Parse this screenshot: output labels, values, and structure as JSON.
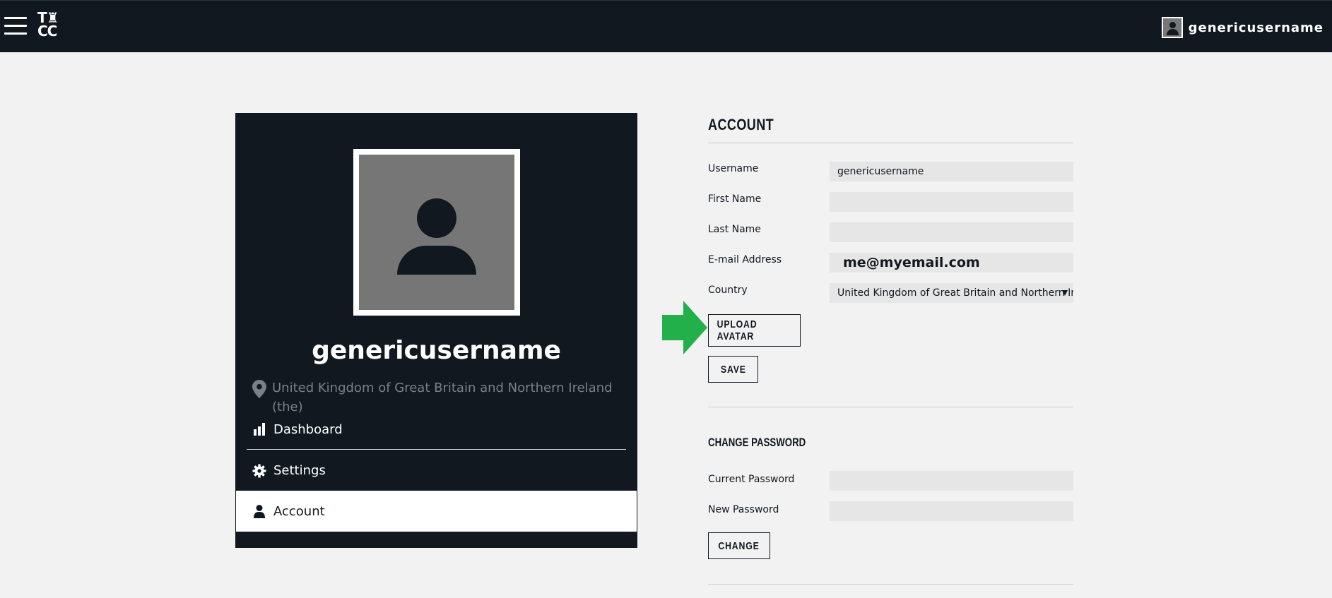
{
  "header": {
    "logo_line1": "T♜",
    "logo_line2": "CC",
    "username": "genericusername"
  },
  "profile": {
    "display_name": "genericusername",
    "location": "United Kingdom of Great Britain and Northern Ireland (the)"
  },
  "sidebar": {
    "items": [
      {
        "label": "Dashboard",
        "icon": "bar-chart-icon"
      },
      {
        "label": "Settings",
        "icon": "gear-icon"
      },
      {
        "label": "Account",
        "icon": "user-icon",
        "active": true
      }
    ]
  },
  "account": {
    "heading": "ACCOUNT",
    "fields": {
      "username_label": "Username",
      "username_value": "genericusername",
      "first_name_label": "First Name",
      "first_name_value": "",
      "last_name_label": "Last Name",
      "last_name_value": "",
      "email_label": "E-mail Address",
      "email_value": "me@myemail.com",
      "country_label": "Country",
      "country_value": "United Kingdom of Great Britain and Northern Ireland (the)"
    },
    "upload_avatar_label": "UPLOAD AVATAR",
    "save_label": "SAVE"
  },
  "password": {
    "heading": "CHANGE PASSWORD",
    "current_label": "Current Password",
    "new_label": "New Password",
    "change_label": "CHANGE"
  },
  "colors": {
    "dark": "#111820",
    "background": "#f2f2f2",
    "field": "#e6e6e6",
    "annotation_arrow": "#22b04b"
  }
}
